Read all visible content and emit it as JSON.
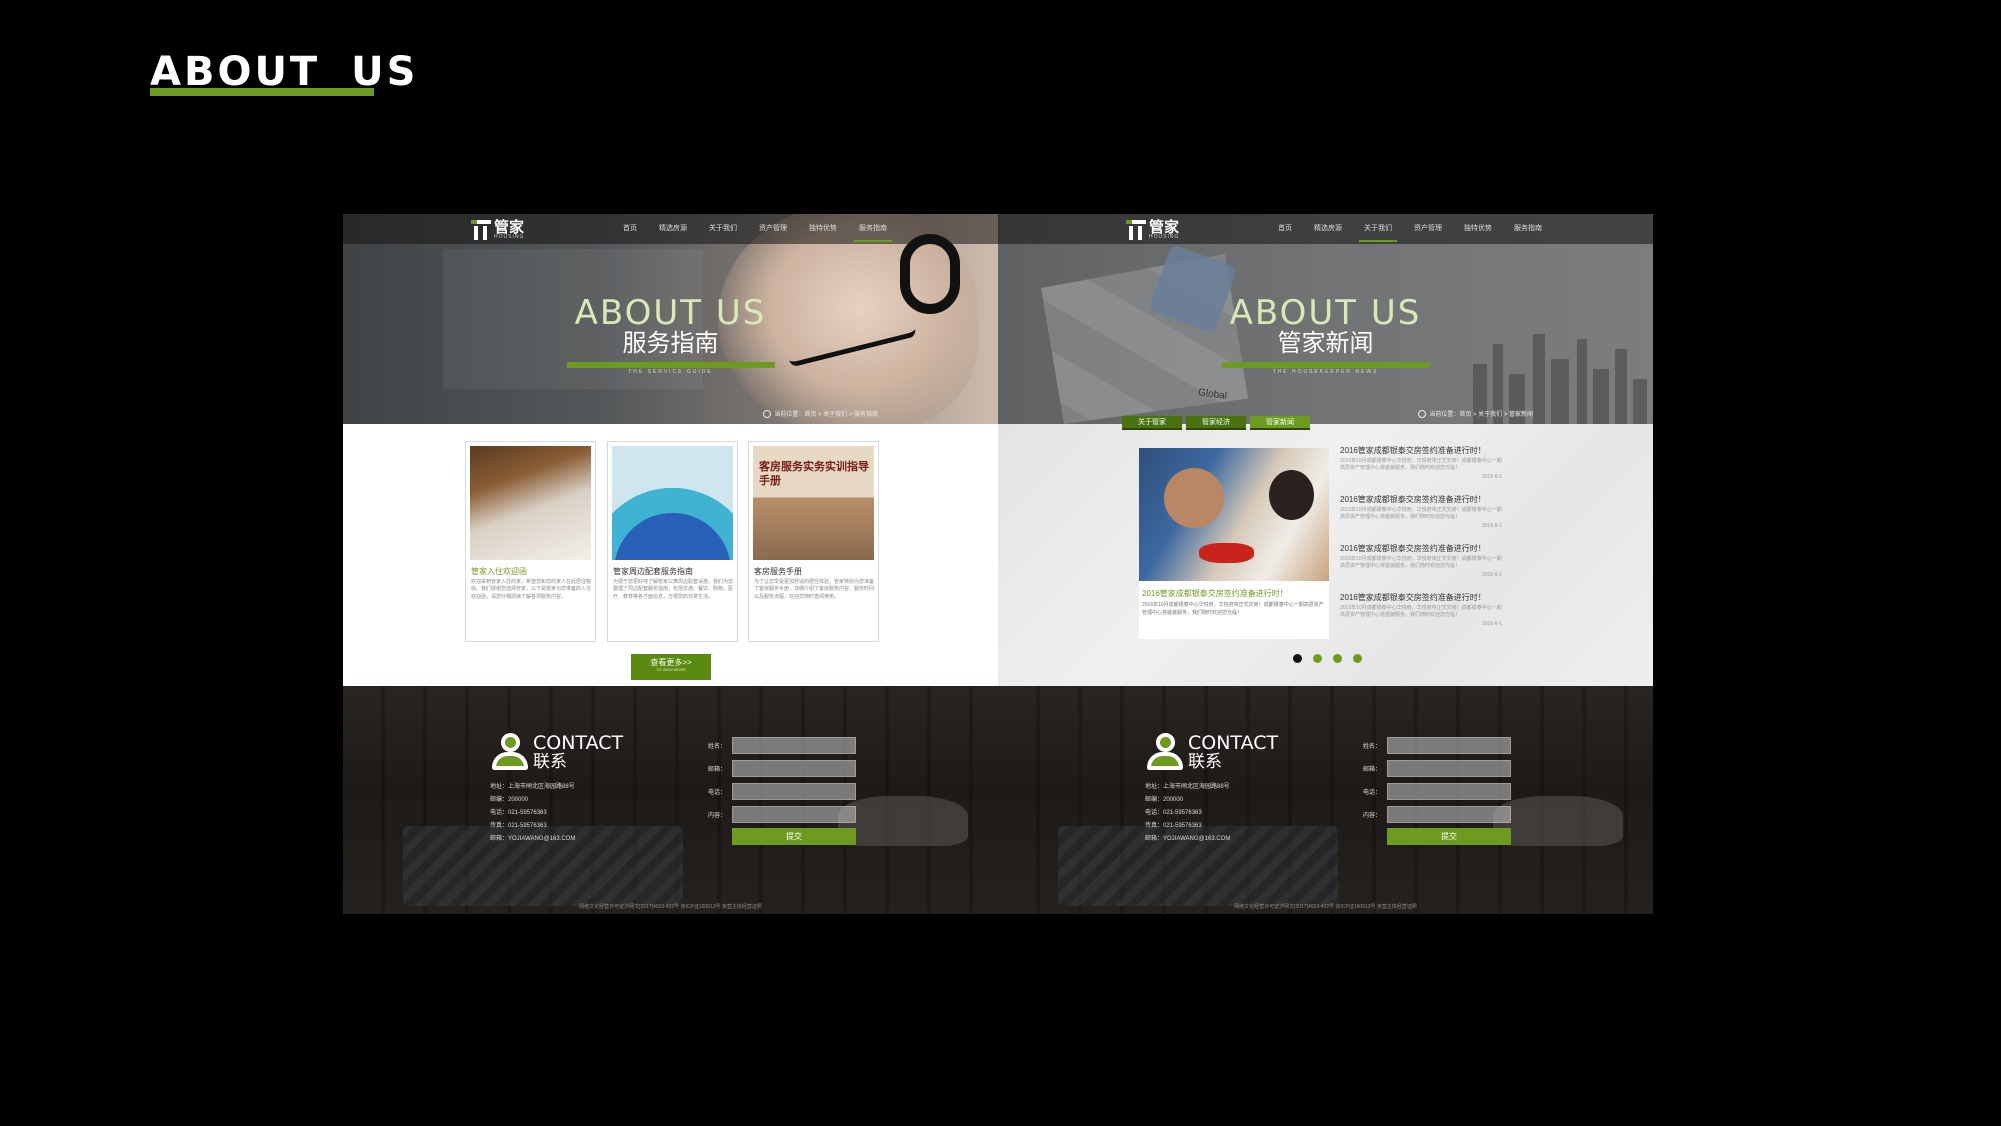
{
  "page": {
    "title": "ABOUT  US",
    "accent_color": "#6d9b1f"
  },
  "nav": {
    "logo_cn": "管家",
    "logo_en": "HOUSING",
    "items": [
      "首页",
      "精选房源",
      "关于我们",
      "资产管理",
      "独特优势",
      "服务指南"
    ]
  },
  "left": {
    "hero_en": "ABOUT US",
    "hero_cn": "服务指南",
    "hero_sub": "THE SERVICE GUIDE",
    "breadcrumb": "当前位置：首页 > 关于我们 > 服务指南",
    "cards": [
      {
        "title": "管家入住欢迎函",
        "body": "欢迎来到管家入住的家，希望您和您的家人在此居住愉快。我们感谢您选择管家，以下是管家为您准备的入住欢迎函，请您仔细阅读了解各项服务内容。"
      },
      {
        "title": "管家周边配套服务指南",
        "body": "为便于您更好地了解管家公寓周边配套设施，我们为您整理了周边配套服务指南，包括交通、餐饮、购物、医疗、教育等各方面信息，方便您的日常生活。"
      },
      {
        "title": "客房服务手册",
        "body": "为了让您享受更加舒适的居住体验，管家特别为您准备了客房服务手册，详细介绍了客房服务内容、服务时间以及服务流程，欢迎您随时查阅使用。",
        "image_text": "客房服务实务实训指导手册"
      }
    ],
    "more_button": "查看更多>>",
    "more_button_en": "TO VIEW MORE"
  },
  "right": {
    "hero_en": "ABOUT US",
    "hero_cn": "管家新闻",
    "hero_sub": "THE HOUSEKEEPER NEWS",
    "hero_image_text": "Global",
    "breadcrumb": "当前位置：首页 > 关于我们 > 管家新闻",
    "tabs": [
      "关于管家",
      "管家经济",
      "管家新闻"
    ],
    "main_news": {
      "title": "2016管家成都银泰交房签约准备进行时！",
      "body": "2016年10月成都银泰中心华悦府，华悦府将正式交房！成都银泰中心一期高层资产管理中心将盛装服务，我们随时欢迎您光临！"
    },
    "news_items": [
      {
        "title": "2016管家成都银泰交房签约准备进行时！",
        "body": "2016年10月成都银泰中心华悦府，华悦府将正式交房！成都银泰中心一期高层资产管理中心将盛装服务，我们随时欢迎您光临！",
        "date": "2016-6-1"
      },
      {
        "title": "2016管家成都银泰交房签约准备进行时！",
        "body": "2016年10月成都银泰中心华悦府，华悦府将正式交房！成都银泰中心一期高层资产管理中心将盛装服务，我们随时欢迎您光临！",
        "date": "2016-6-1"
      },
      {
        "title": "2016管家成都银泰交房签约准备进行时！",
        "body": "2016年10月成都银泰中心华悦府，华悦府将正式交房！成都银泰中心一期高层资产管理中心将盛装服务，我们随时欢迎您光临！",
        "date": "2016-6-1"
      },
      {
        "title": "2016管家成都银泰交房签约准备进行时！",
        "body": "2016年10月成都银泰中心华悦府，华悦府将正式交房！成都银泰中心一期高层资产管理中心将盛装服务，我们随时欢迎您光临！",
        "date": "2016-6-1"
      }
    ]
  },
  "contact": {
    "title_en": "CONTACT",
    "title_cn": "联系",
    "info": [
      "地址：上海市闸北区海园路88号",
      "邮编：200000",
      "电话：021-59576363",
      "传真：021-59576363",
      "邮箱：YOJIAWANG@163.COM"
    ],
    "form_labels": [
      "姓名：",
      "邮箱：",
      "电话：",
      "内容："
    ],
    "submit": "提交",
    "copyright": "网络文化经营许可证沪网文[2017]4023-432号  京ICP证160913号  京营主体经营证照"
  }
}
